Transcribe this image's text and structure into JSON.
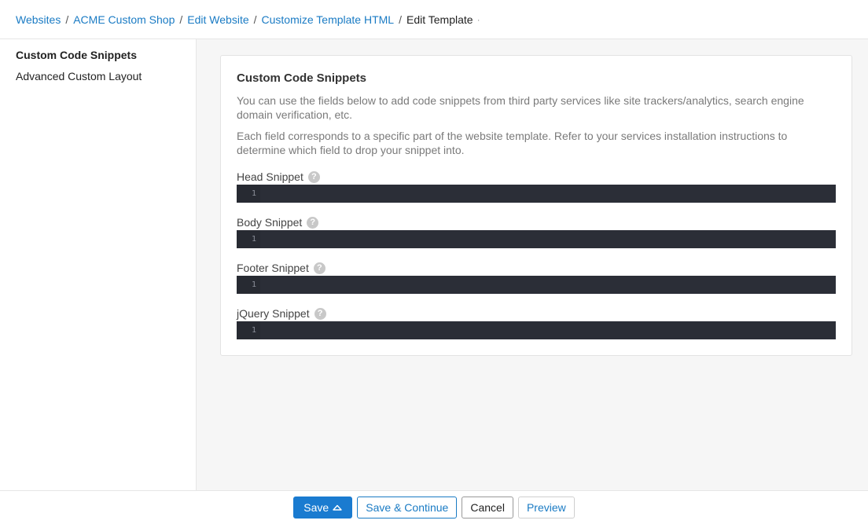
{
  "breadcrumb": {
    "items": [
      {
        "label": "Websites"
      },
      {
        "label": "ACME Custom Shop"
      },
      {
        "label": "Edit Website"
      },
      {
        "label": "Customize Template HTML"
      }
    ],
    "current": "Edit Template",
    "trailing": "·"
  },
  "sidebar": {
    "items": [
      {
        "label": "Custom Code Snippets",
        "active": true
      },
      {
        "label": "Advanced Custom Layout",
        "active": false
      }
    ]
  },
  "main": {
    "card": {
      "title": "Custom Code Snippets",
      "desc1": "You can use the fields below to add code snippets from third party services like site trackers/analytics, search engine domain verification, etc.",
      "desc2": "Each field corresponds to a specific part of the website template. Refer to your services installation instructions to determine which field to drop your snippet into.",
      "fields": [
        {
          "label": "Head Snippet",
          "help": "?",
          "line": "1"
        },
        {
          "label": "Body Snippet",
          "help": "?",
          "line": "1"
        },
        {
          "label": "Footer Snippet",
          "help": "?",
          "line": "1"
        },
        {
          "label": "jQuery Snippet",
          "help": "?",
          "line": "1"
        }
      ]
    }
  },
  "footer": {
    "save_label": "Save",
    "save_continue_label": "Save & Continue",
    "cancel_label": "Cancel",
    "preview_label": "Preview"
  },
  "colors": {
    "accent": "#1a7bd0",
    "link": "#1a7bc4",
    "editor_bg": "#2b2e37",
    "main_bg": "#f6f6f6"
  }
}
